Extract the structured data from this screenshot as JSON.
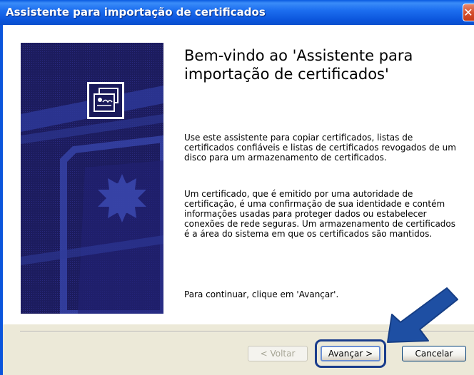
{
  "window": {
    "title": "Assistente para importação de certificados"
  },
  "main": {
    "heading": "Bem-vindo ao 'Assistente para importação de certificados'",
    "paragraph1": "Use este assistente para copiar certificados, listas de certificados confiáveis e listas de certificados revogados de um disco para um armazenamento de certificados.",
    "paragraph2": "Um certificado, que é emitido por uma autoridade de certificação, é uma confirmação de sua identidade e contém informações usadas para proteger dados ou estabelecer conexões de rede seguras. Um armazenamento de certificados é a área do sistema em que os certificados são mantidos.",
    "paragraph3": "Para continuar, clique em 'Avançar'."
  },
  "buttons": {
    "back": "< Voltar",
    "next": "Avançar >",
    "cancel": "Cancelar"
  },
  "icons": {
    "close": "close-icon",
    "certificate": "certificate-icon",
    "arrow": "pointer-arrow-icon"
  },
  "colors": {
    "titlebar": "#0b55dc",
    "banner": "#1a1a5a",
    "highlight": "#1a3d8c"
  }
}
